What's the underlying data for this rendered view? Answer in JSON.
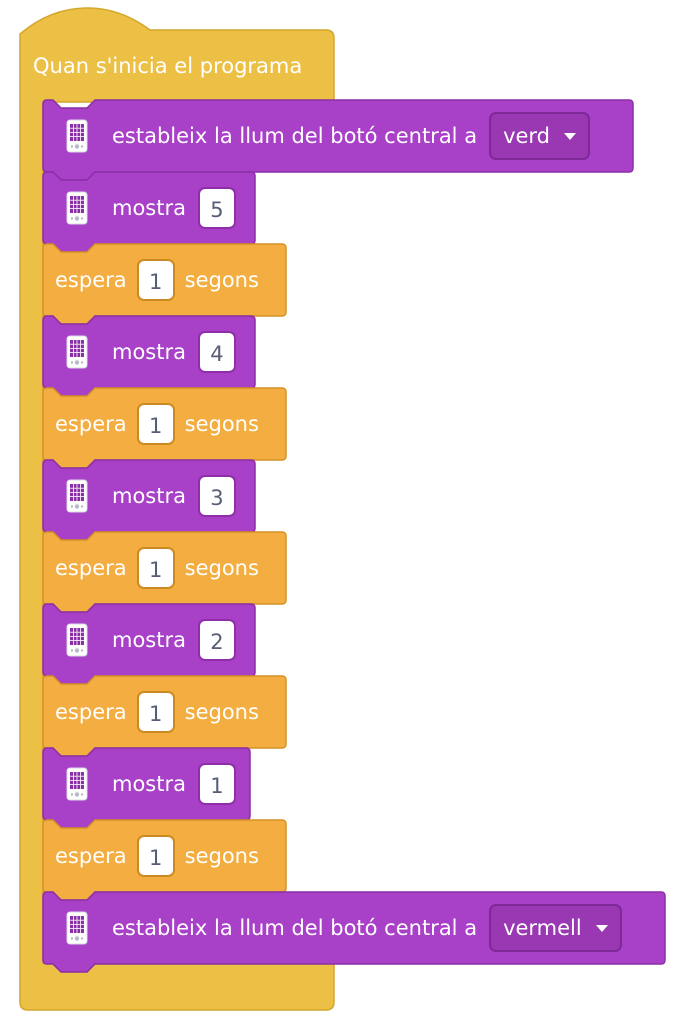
{
  "colors": {
    "event": "#ecc045",
    "event_border": "#d4a62e",
    "looks": "#a940c8",
    "looks_border": "#8a2fa6",
    "control": "#f3ad40",
    "control_border": "#d69325",
    "field_text": "#575e75"
  },
  "hat": {
    "label": "Quan s'inicia el programa"
  },
  "blocks": [
    {
      "kind": "looks",
      "icon": "device-icon",
      "text": "estableix la llum del botó central a",
      "dropdown": "verd"
    },
    {
      "kind": "looks",
      "icon": "device-icon",
      "text": "mostra",
      "value": "5"
    },
    {
      "kind": "control",
      "text": "espera",
      "value": "1",
      "suffix": "segons"
    },
    {
      "kind": "looks",
      "icon": "device-icon",
      "text": "mostra",
      "value": "4"
    },
    {
      "kind": "control",
      "text": "espera",
      "value": "1",
      "suffix": "segons"
    },
    {
      "kind": "looks",
      "icon": "device-icon",
      "text": "mostra",
      "value": "3"
    },
    {
      "kind": "control",
      "text": "espera",
      "value": "1",
      "suffix": "segons"
    },
    {
      "kind": "looks",
      "icon": "device-icon",
      "text": "mostra",
      "value": "2"
    },
    {
      "kind": "control",
      "text": "espera",
      "value": "1",
      "suffix": "segons"
    },
    {
      "kind": "looks",
      "icon": "device-icon",
      "text": "mostra",
      "value": "1"
    },
    {
      "kind": "control",
      "text": "espera",
      "value": "1",
      "suffix": "segons"
    },
    {
      "kind": "looks",
      "icon": "device-icon",
      "text": "estableix la llum del botó central a",
      "dropdown": "vermell"
    }
  ]
}
